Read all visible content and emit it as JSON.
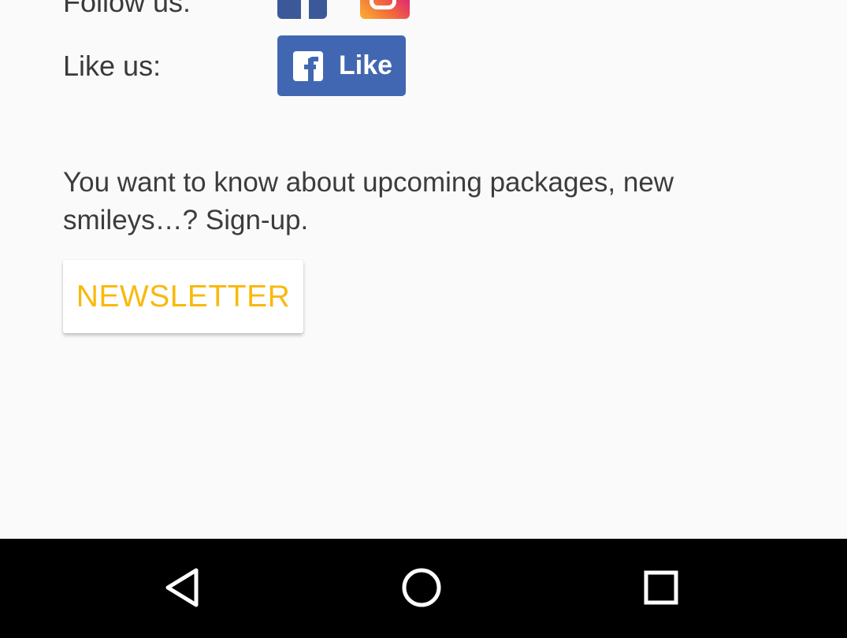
{
  "social": {
    "follow_label": "Follow us:",
    "like_label": "Like us:",
    "follow_icons": [
      "facebook-icon",
      "instagram-icon"
    ],
    "like_button_label": "Like",
    "facebook_color": "#3b5998",
    "like_button_color": "#4267b2"
  },
  "signup": {
    "text": "You want to know about upcoming packages, new smileys…? Sign-up.",
    "button_label": "NEWSLETTER",
    "button_color": "#f9b90d"
  },
  "navbar": {
    "buttons": [
      "back-icon",
      "home-icon",
      "recents-icon"
    ]
  }
}
